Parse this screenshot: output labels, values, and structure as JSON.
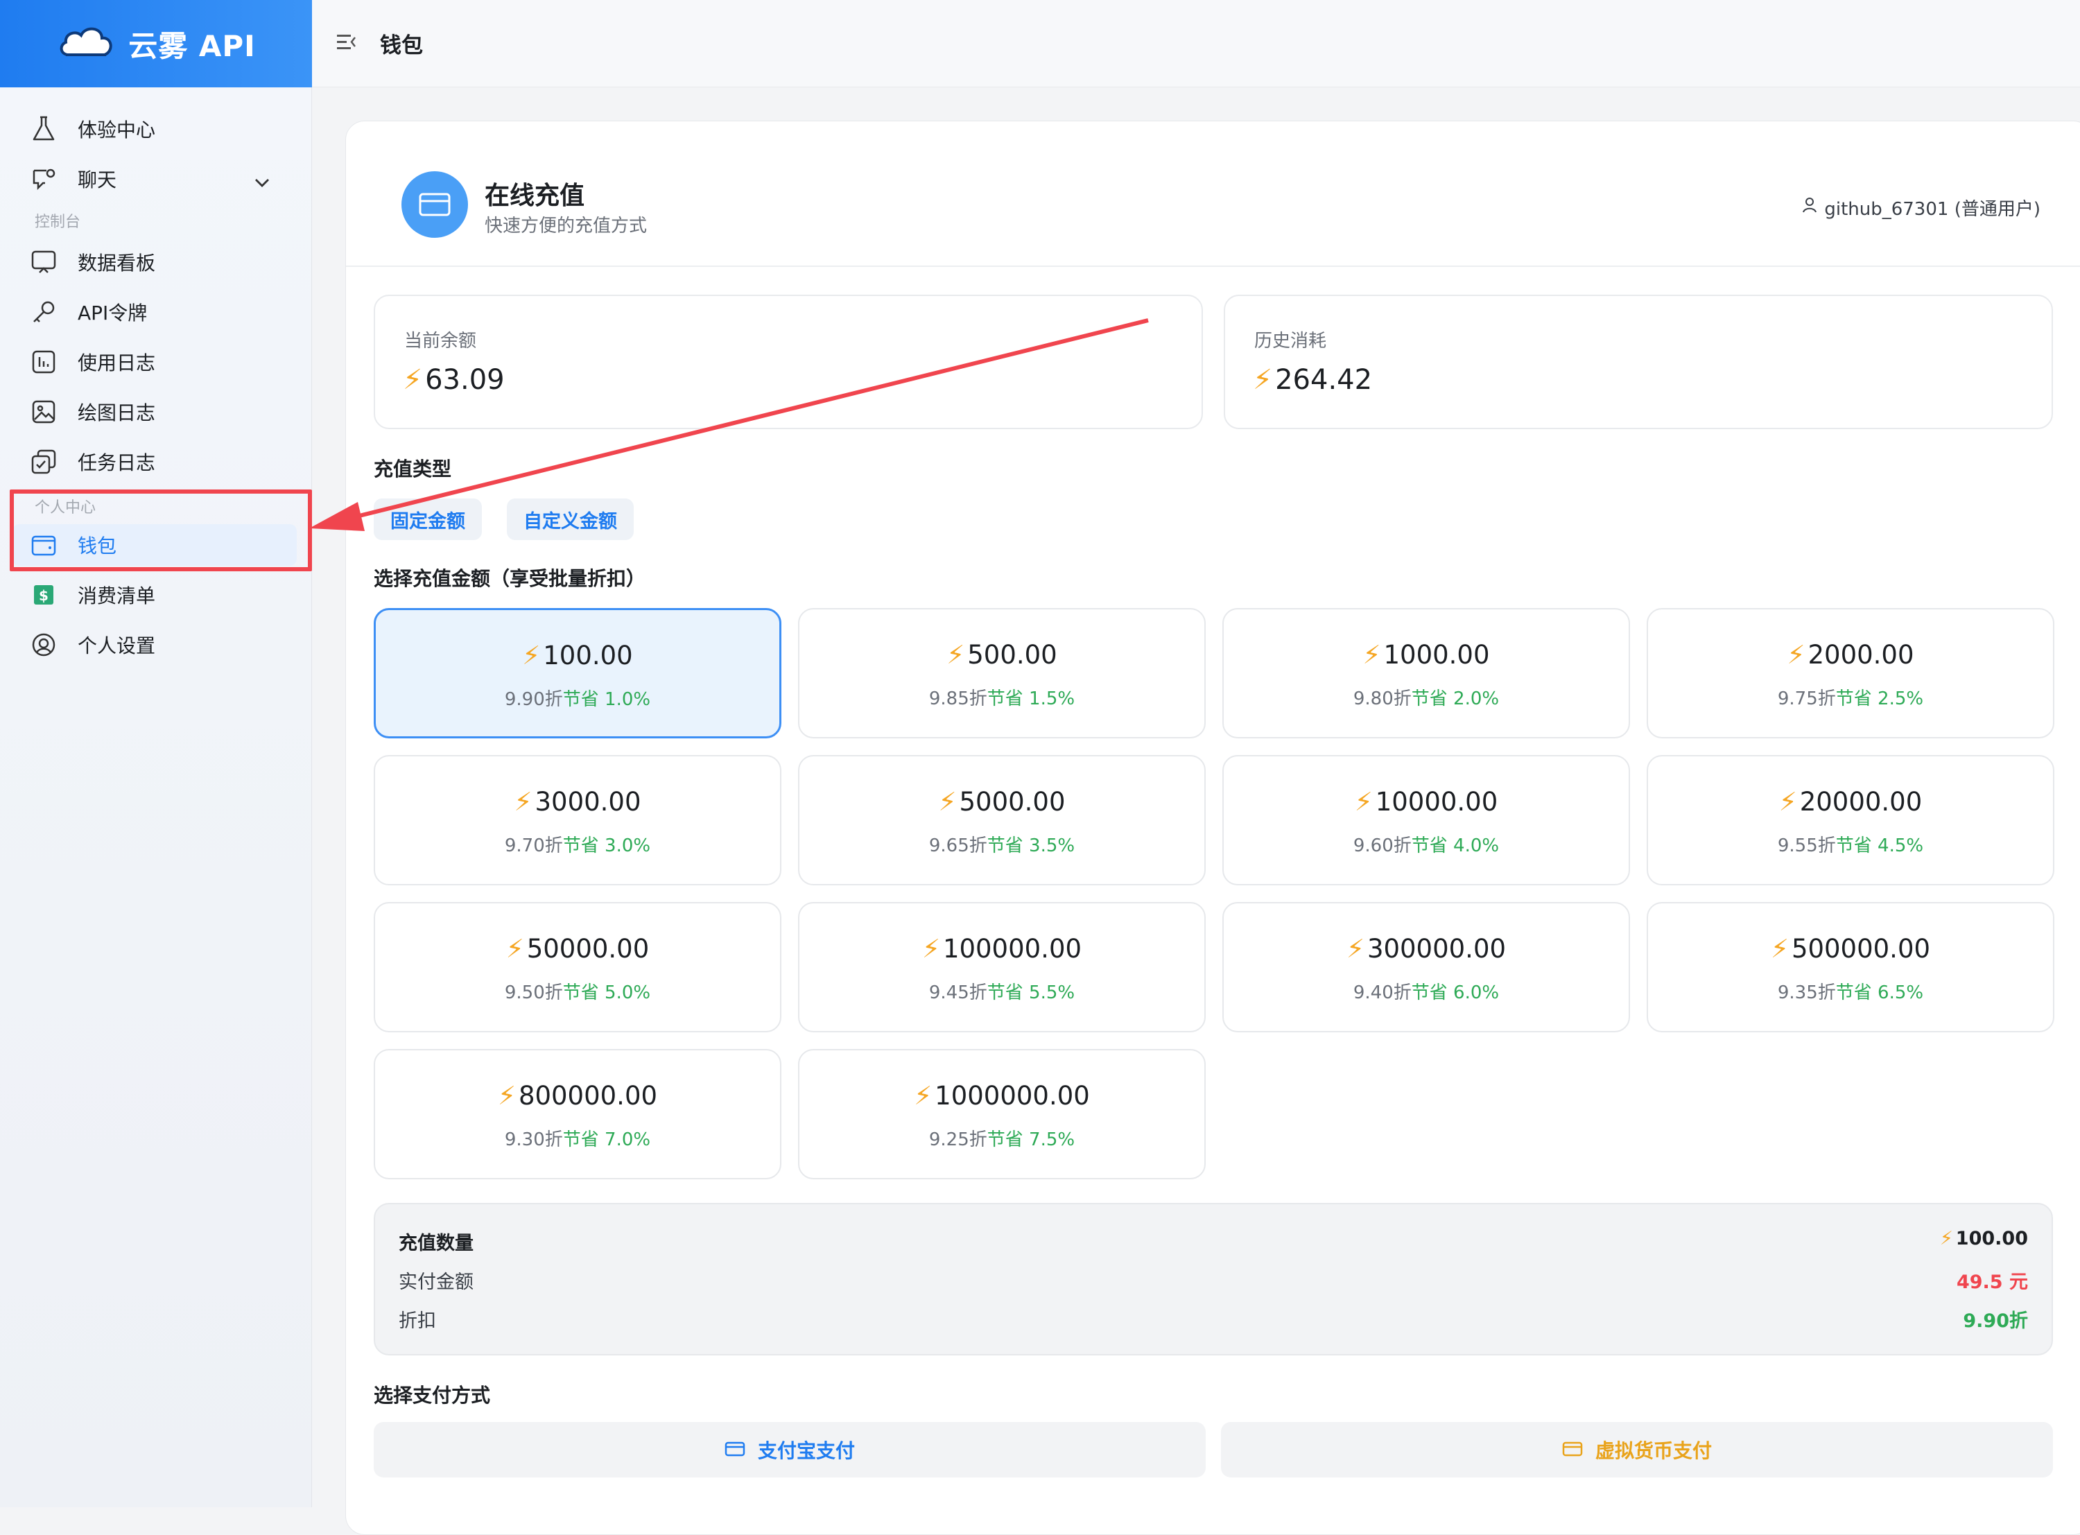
{
  "app": {
    "brand": "云雾 API",
    "header_title": "钱包"
  },
  "sidebar": {
    "items_top": [
      {
        "label": "体验中心",
        "icon": "flask-icon"
      },
      {
        "label": "聊天",
        "icon": "chat-icon"
      }
    ],
    "section_console": "控制台",
    "items_console": [
      {
        "label": "数据看板",
        "icon": "dashboard-icon"
      },
      {
        "label": "API令牌",
        "icon": "key-icon"
      },
      {
        "label": "使用日志",
        "icon": "log-icon"
      },
      {
        "label": "绘图日志",
        "icon": "image-icon"
      },
      {
        "label": "任务日志",
        "icon": "task-icon"
      }
    ],
    "section_personal": "个人中心",
    "items_personal": [
      {
        "label": "钱包",
        "icon": "wallet-icon",
        "active": true
      },
      {
        "label": "消费清单",
        "icon": "dollar-icon"
      },
      {
        "label": "个人设置",
        "icon": "user-circle-icon"
      }
    ]
  },
  "card": {
    "title": "在线充值",
    "subtitle": "快速方便的充值方式",
    "user": "github_67301 (普通用户)"
  },
  "stats": {
    "balance_label": "当前余额",
    "balance_value": "63.09",
    "history_label": "历史消耗",
    "history_value": "264.42"
  },
  "recharge": {
    "type_label": "充值类型",
    "types": [
      "固定金额",
      "自定义金额"
    ],
    "amount_label": "选择充值金额（享受批量折扣）",
    "amounts": [
      {
        "value": "100.00",
        "discount": "9.90折",
        "save": "节省 1.0%",
        "selected": true
      },
      {
        "value": "500.00",
        "discount": "9.85折",
        "save": "节省 1.5%"
      },
      {
        "value": "1000.00",
        "discount": "9.80折",
        "save": "节省 2.0%"
      },
      {
        "value": "2000.00",
        "discount": "9.75折",
        "save": "节省 2.5%"
      },
      {
        "value": "3000.00",
        "discount": "9.70折",
        "save": "节省 3.0%"
      },
      {
        "value": "5000.00",
        "discount": "9.65折",
        "save": "节省 3.5%"
      },
      {
        "value": "10000.00",
        "discount": "9.60折",
        "save": "节省 4.0%"
      },
      {
        "value": "20000.00",
        "discount": "9.55折",
        "save": "节省 4.5%"
      },
      {
        "value": "50000.00",
        "discount": "9.50折",
        "save": "节省 5.0%"
      },
      {
        "value": "100000.00",
        "discount": "9.45折",
        "save": "节省 5.5%"
      },
      {
        "value": "300000.00",
        "discount": "9.40折",
        "save": "节省 6.0%"
      },
      {
        "value": "500000.00",
        "discount": "9.35折",
        "save": "节省 6.5%"
      },
      {
        "value": "800000.00",
        "discount": "9.30折",
        "save": "节省 7.0%"
      },
      {
        "value": "1000000.00",
        "discount": "9.25折",
        "save": "节省 7.5%"
      }
    ]
  },
  "summary": {
    "qty_label": "充值数量",
    "qty_value": "100.00",
    "paid_label": "实付金额",
    "paid_value": "49.5 元",
    "discount_label": "折扣",
    "discount_value": "9.90折"
  },
  "payment": {
    "label": "选择支付方式",
    "alipay": "支付宝支付",
    "crypto": "虚拟货币支付"
  },
  "colors": {
    "brand": "#1f7cf0",
    "annotation": "#f0454e",
    "save_green": "#2eaa56",
    "paid_red": "#f0454e",
    "crypto_orange": "#e9a31b"
  }
}
